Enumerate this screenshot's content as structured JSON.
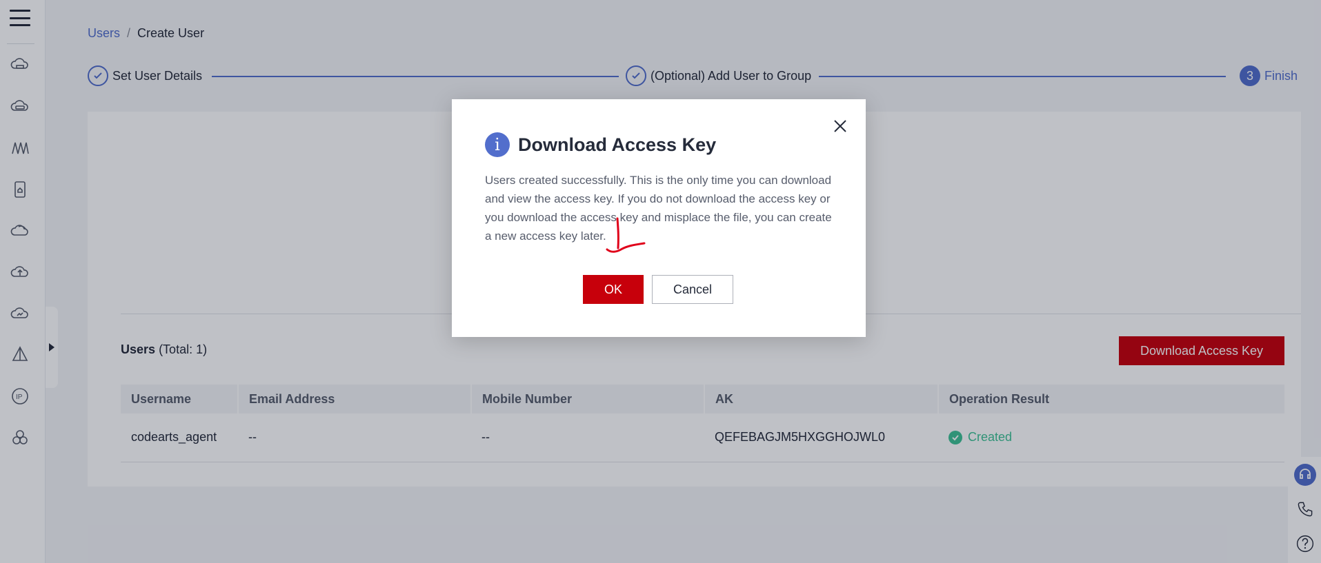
{
  "breadcrumb": {
    "root": "Users",
    "separator": "/",
    "current": "Create User"
  },
  "steps": [
    {
      "label": "Set User Details",
      "state": "done"
    },
    {
      "label": "(Optional) Add User to Group",
      "state": "done"
    },
    {
      "number": "3",
      "label": "Finish",
      "state": "active"
    }
  ],
  "users_section": {
    "title": "Users",
    "total": "(Total: 1)",
    "download_button": "Download Access Key"
  },
  "table": {
    "headers": [
      "Username",
      "Email Address",
      "Mobile Number",
      "AK",
      "Operation Result"
    ],
    "rows": [
      {
        "username": "codearts_agent",
        "email": "--",
        "mobile": "--",
        "ak": "QEFEBAGJM5HXGGHOJWL0",
        "result": "Created"
      }
    ]
  },
  "nav_icons": [
    "cloud-server-icon",
    "cloud-database-icon",
    "network-icon",
    "storage-icon",
    "cloud-icon",
    "cloud-upload-icon",
    "cloud-monitor-icon",
    "deploy-icon",
    "ip-icon",
    "cluster-icon"
  ],
  "modal": {
    "title": "Download Access Key",
    "body": "Users created successfully. This is the only time you can download and view the access key. If you do not download the access key or you download the access key and misplace the file, you can create a new access key later.",
    "ok": "OK",
    "cancel": "Cancel"
  },
  "colors": {
    "accent": "#526ecc",
    "danger": "#c7000b",
    "success": "#3ec295",
    "annotation": "#e0001a"
  }
}
